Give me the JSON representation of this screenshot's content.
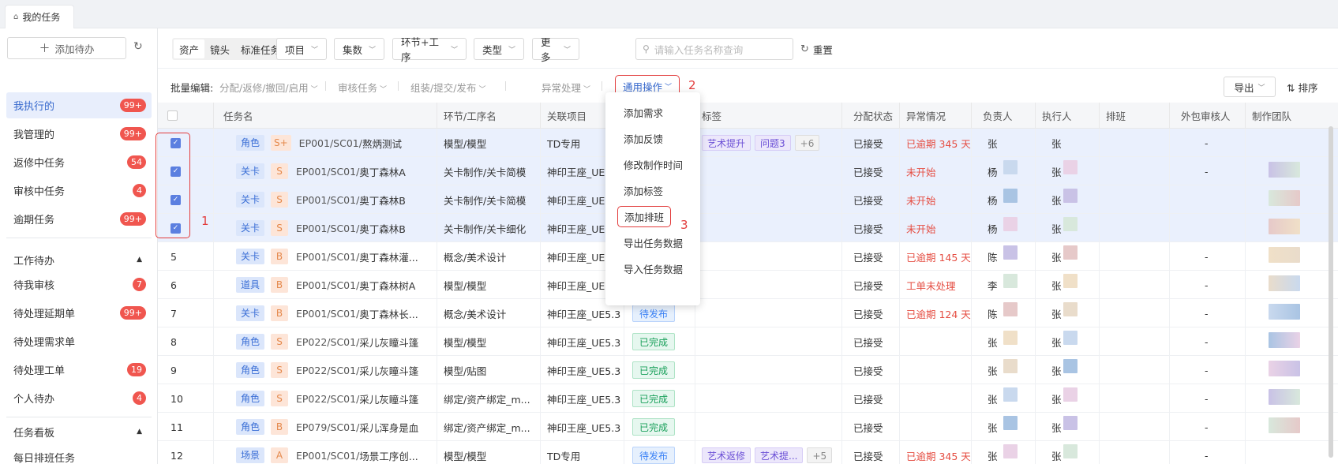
{
  "tab": {
    "label": "我的任务"
  },
  "sidebar": {
    "add_label": "添加待办",
    "items": [
      {
        "label": "我执行的",
        "badge": "99+"
      },
      {
        "label": "我管理的",
        "badge": "99+"
      },
      {
        "label": "返修中任务",
        "badge": "54"
      },
      {
        "label": "审核中任务",
        "badge": "4"
      },
      {
        "label": "逾期任务",
        "badge": "99+"
      }
    ],
    "group1": "工作待办",
    "group1_items": [
      {
        "label": "待我审核",
        "badge": "7"
      },
      {
        "label": "待处理延期单",
        "badge": "99+"
      },
      {
        "label": "待处理需求单",
        "badge": ""
      },
      {
        "label": "待处理工单",
        "badge": "19"
      },
      {
        "label": "个人待办",
        "badge": "4"
      }
    ],
    "group2": "任务看板",
    "group2_items": [
      {
        "label": "每日排班任务"
      }
    ]
  },
  "filters": {
    "seg": [
      "资产",
      "镜头",
      "标准任务"
    ],
    "dropdowns": [
      "项目",
      "集数",
      "环节+工序",
      "类型",
      "更多"
    ],
    "search_placeholder": "请输入任务名称查询",
    "reset": "重置"
  },
  "batch": {
    "label": "批量编辑:",
    "ops": [
      "分配/返修/撤回/启用",
      "审核任务",
      "组装/提交/发布",
      "异常处理"
    ],
    "general": "通用操作",
    "export": "导出",
    "sort": "排序"
  },
  "annotations": {
    "a1": "1",
    "a2": "2",
    "a3": "3"
  },
  "menu": [
    "添加需求",
    "添加反馈",
    "修改制作时间",
    "添加标签",
    "添加排班",
    "导出任务数据",
    "导入任务数据"
  ],
  "columns": [
    "任务名",
    "环节/工序名",
    "关联项目",
    "标签",
    "分配状态",
    "异常情况",
    "负责人",
    "执行人",
    "排班",
    "外包审核人",
    "制作团队"
  ],
  "rows": [
    {
      "no": "",
      "checked": true,
      "type": "角色",
      "level": "S+",
      "ep": "EP001/SC01/",
      "name": "熬炳测试",
      "step": "模型/模型",
      "proj": "TD专用",
      "status": "",
      "tags": [
        "艺术提升",
        "问题3"
      ],
      "tags_more": "+6",
      "assign": "已接受",
      "exc": "已逾期 345 天",
      "owner": "张",
      "exec": "张",
      "outsrc": "-"
    },
    {
      "no": "",
      "checked": true,
      "type": "关卡",
      "level": "S",
      "ep": "EP001/SC01/",
      "name": "奥丁森林A",
      "step": "关卡制作/关卡简模",
      "proj": "神印王座_UE5",
      "status": "",
      "tags": [],
      "tags_more": "",
      "assign": "已接受",
      "exc": "未开始",
      "owner": "杨",
      "exec": "张",
      "outsrc": "-"
    },
    {
      "no": "",
      "checked": true,
      "type": "关卡",
      "level": "S",
      "ep": "EP001/SC01/",
      "name": "奥丁森林B",
      "step": "关卡制作/关卡简模",
      "proj": "神印王座_UE5",
      "status": "",
      "tags": [],
      "tags_more": "",
      "assign": "已接受",
      "exc": "未开始",
      "owner": "杨",
      "exec": "张",
      "outsrc": ""
    },
    {
      "no": "",
      "checked": true,
      "type": "关卡",
      "level": "S",
      "ep": "EP001/SC01/",
      "name": "奥丁森林B",
      "step": "关卡制作/关卡细化",
      "proj": "神印王座_UE5",
      "status": "",
      "tags": [],
      "tags_more": "",
      "assign": "已接受",
      "exc": "未开始",
      "owner": "杨",
      "exec": "张",
      "outsrc": ""
    },
    {
      "no": "5",
      "checked": false,
      "type": "关卡",
      "level": "B",
      "ep": "EP001/SC01/",
      "name": "奥丁森林灌...",
      "step": "概念/美术设计",
      "proj": "神印王座_UE5",
      "status": "",
      "tags": [],
      "tags_more": "",
      "assign": "已接受",
      "exc": "已逾期 145 天",
      "owner": "陈",
      "exec": "张",
      "outsrc": "-"
    },
    {
      "no": "6",
      "checked": false,
      "type": "道具",
      "level": "B",
      "ep": "EP001/SC01/",
      "name": "奥丁森林树A",
      "step": "模型/模型",
      "proj": "神印王座_UE5",
      "status": "",
      "tags": [],
      "tags_more": "",
      "assign": "已接受",
      "exc": "工单未处理",
      "owner": "李",
      "exec": "张",
      "outsrc": "-"
    },
    {
      "no": "7",
      "checked": false,
      "type": "关卡",
      "level": "B",
      "ep": "EP001/SC01/",
      "name": "奥丁森林长...",
      "step": "概念/美术设计",
      "proj": "神印王座_UE5.3",
      "status": "待发布",
      "tags": [],
      "tags_more": "",
      "assign": "已接受",
      "exc": "已逾期 124 天",
      "owner": "陈",
      "exec": "张",
      "outsrc": "-"
    },
    {
      "no": "8",
      "checked": false,
      "type": "角色",
      "level": "S",
      "ep": "EP022/SC01/",
      "name": "采儿灰瞳斗篷",
      "step": "模型/模型",
      "proj": "神印王座_UE5.3",
      "status": "已完成",
      "tags": [],
      "tags_more": "",
      "assign": "已接受",
      "exc": "",
      "owner": "张",
      "exec": "张",
      "outsrc": "-"
    },
    {
      "no": "9",
      "checked": false,
      "type": "角色",
      "level": "S",
      "ep": "EP022/SC01/",
      "name": "采儿灰瞳斗篷",
      "step": "模型/贴图",
      "proj": "神印王座_UE5.3",
      "status": "已完成",
      "tags": [],
      "tags_more": "",
      "assign": "已接受",
      "exc": "",
      "owner": "张",
      "exec": "张",
      "outsrc": "-"
    },
    {
      "no": "10",
      "checked": false,
      "type": "角色",
      "level": "S",
      "ep": "EP022/SC01/",
      "name": "采儿灰瞳斗篷",
      "step": "绑定/资产绑定_m...",
      "proj": "神印王座_UE5.3",
      "status": "已完成",
      "tags": [],
      "tags_more": "",
      "assign": "已接受",
      "exc": "",
      "owner": "张",
      "exec": "张",
      "outsrc": "-"
    },
    {
      "no": "11",
      "checked": false,
      "type": "角色",
      "level": "B",
      "ep": "EP079/SC01/",
      "name": "采儿浑身是血",
      "step": "绑定/资产绑定_m...",
      "proj": "神印王座_UE5.3",
      "status": "已完成",
      "tags": [],
      "tags_more": "",
      "assign": "已接受",
      "exc": "",
      "owner": "张",
      "exec": "张",
      "outsrc": "-"
    },
    {
      "no": "12",
      "checked": false,
      "type": "场景",
      "level": "A",
      "ep": "EP001/SC01/",
      "name": "场景工序创...",
      "step": "模型/模型",
      "proj": "TD专用",
      "status": "待发布",
      "tags": [
        "艺术返修",
        "艺术提..."
      ],
      "tags_more": "+5",
      "assign": "已接受",
      "exc": "已逾期 345 天",
      "owner": "张",
      "exec": "张",
      "outsrc": "-"
    }
  ]
}
